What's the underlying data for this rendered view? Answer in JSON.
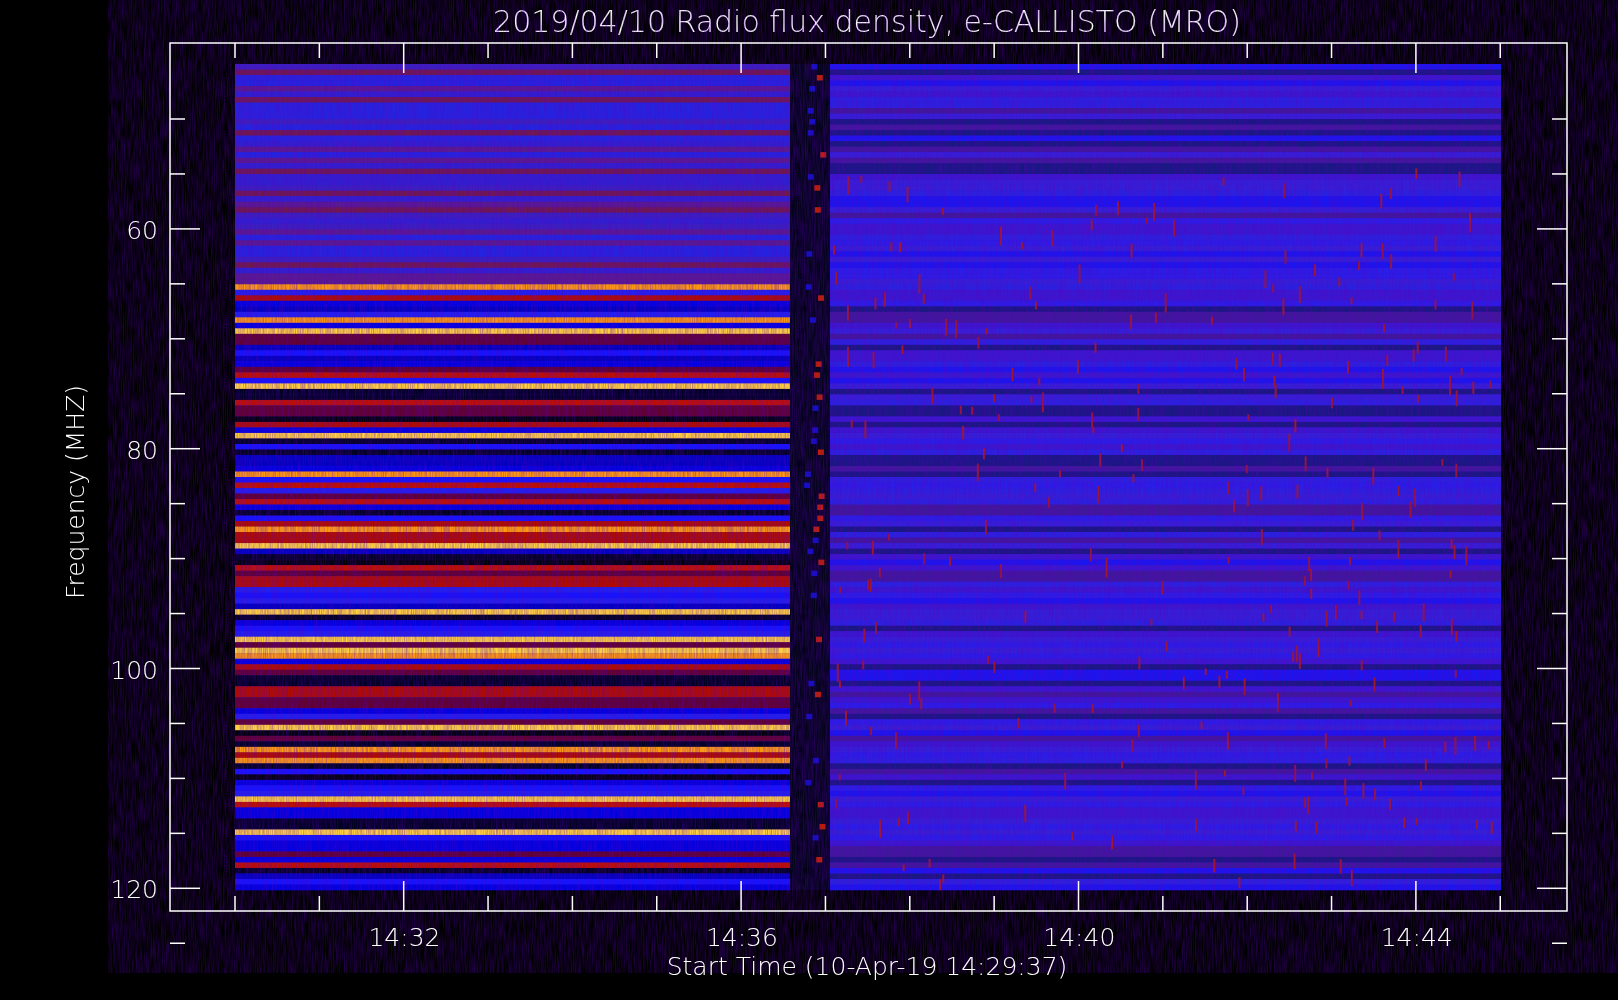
{
  "plot": {
    "title": "2019/04/10  Radio flux density, e-CALLISTO (MRO)",
    "ylabel": "Frequency (MHZ)",
    "xlabel": "Start Time (10-Apr-19 14:29:37)",
    "yticks": [
      "60",
      "80",
      "100",
      "120"
    ],
    "xticks": [
      "14:32",
      "14:36",
      "14:40",
      "14:44"
    ]
  }
}
